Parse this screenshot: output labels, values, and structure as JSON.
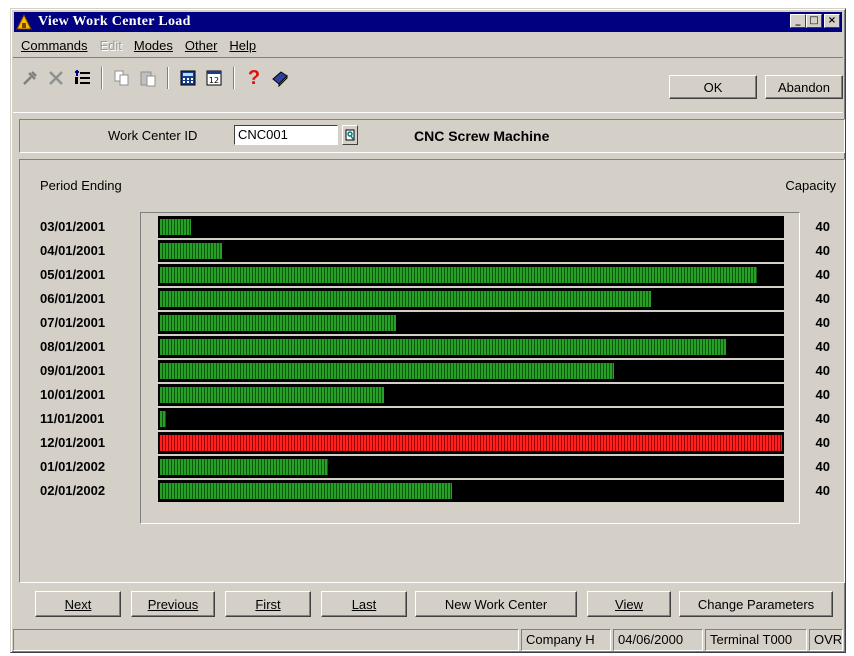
{
  "window": {
    "title": "View Work Center Load",
    "min_glyph": "_",
    "max_glyph": "□",
    "close_glyph": "×"
  },
  "menu": [
    {
      "label": "Commands",
      "disabled": false
    },
    {
      "label": "Edit",
      "disabled": true
    },
    {
      "label": "Modes",
      "disabled": false
    },
    {
      "label": "Other",
      "disabled": false
    },
    {
      "label": "Help",
      "disabled": false
    }
  ],
  "toolbar": {
    "icons": [
      "tools-icon",
      "delete-icon",
      "list-icon",
      "copy-icon",
      "paste-icon",
      "calculator-icon",
      "calendar-icon",
      "help-icon",
      "book-icon"
    ],
    "ok_label": "OK",
    "abandon_label": "Abandon"
  },
  "header": {
    "wc_label": "Work Center ID",
    "wc_value": "CNC001",
    "wc_description": "CNC Screw Machine"
  },
  "chart_labels": {
    "period_label": "Period Ending",
    "capacity_label": "Capacity"
  },
  "chart_data": {
    "type": "bar",
    "orientation": "horizontal",
    "categories": [
      "03/01/2001",
      "04/01/2001",
      "05/01/2001",
      "06/01/2001",
      "07/01/2001",
      "08/01/2001",
      "09/01/2001",
      "10/01/2001",
      "11/01/2001",
      "12/01/2001",
      "01/01/2002",
      "02/01/2002"
    ],
    "capacity": [
      40,
      40,
      40,
      40,
      40,
      40,
      40,
      40,
      40,
      40,
      40,
      40
    ],
    "load_fraction": [
      0.05,
      0.1,
      0.96,
      0.79,
      0.38,
      0.91,
      0.73,
      0.36,
      0.01,
      1.0,
      0.27,
      0.47
    ],
    "over_capacity": [
      false,
      false,
      false,
      false,
      false,
      false,
      false,
      false,
      false,
      true,
      false,
      false
    ],
    "colors": {
      "normal": "#28a028",
      "over": "#ff2020",
      "track": "#000000"
    }
  },
  "buttons": [
    {
      "label": "Next",
      "name": "next-button"
    },
    {
      "label": "Previous",
      "name": "previous-button"
    },
    {
      "label": "First",
      "name": "first-button"
    },
    {
      "label": "Last",
      "name": "last-button"
    },
    {
      "label": "New Work Center",
      "name": "new-work-center-button"
    },
    {
      "label": "View",
      "name": "view-button"
    },
    {
      "label": "Change Parameters",
      "name": "change-parameters-button"
    }
  ],
  "status": {
    "company": "Company H",
    "date": "04/06/2000",
    "terminal": "Terminal T000",
    "mode": "OVR"
  }
}
